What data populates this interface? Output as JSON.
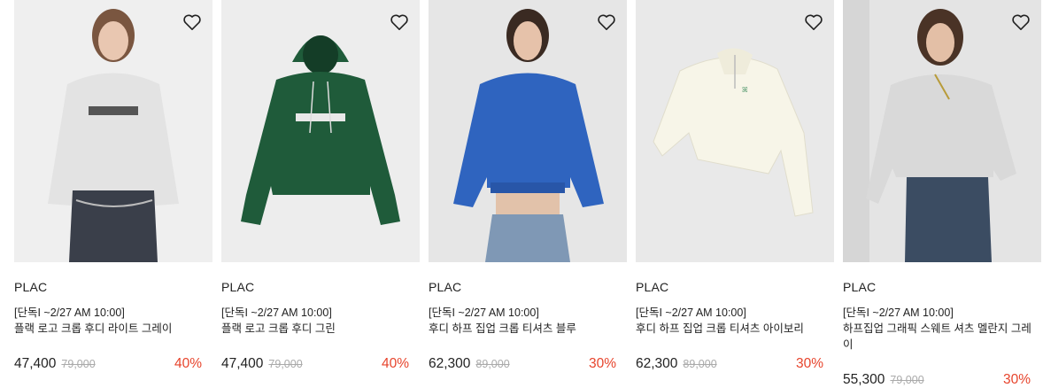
{
  "products": [
    {
      "brand": "PLAC",
      "tag": "[단독I ~2/27 AM 10:00]",
      "name": "플랙 로고 크롭 후디 라이트 그레이",
      "sale_price": "47,400",
      "original_price": "79,000",
      "discount": "40%",
      "garment_color": "#e4e4e4",
      "wish_icon": "heart-outline-icon"
    },
    {
      "brand": "PLAC",
      "tag": "[단독I ~2/27 AM 10:00]",
      "name": "플랙 로고 크롭 후디 그린",
      "sale_price": "47,400",
      "original_price": "79,000",
      "discount": "40%",
      "garment_color": "#1f5b3a",
      "wish_icon": "heart-outline-icon"
    },
    {
      "brand": "PLAC",
      "tag": "[단독I ~2/27 AM 10:00]",
      "name": "후디 하프 집업 크롭 티셔츠 블루",
      "sale_price": "62,300",
      "original_price": "89,000",
      "discount": "30%",
      "garment_color": "#2f64bf",
      "wish_icon": "heart-outline-icon"
    },
    {
      "brand": "PLAC",
      "tag": "[단독I ~2/27 AM 10:00]",
      "name": "후디 하프 집업 크롭 티셔츠 아이보리",
      "sale_price": "62,300",
      "original_price": "89,000",
      "discount": "30%",
      "garment_color": "#f6f4e6",
      "wish_icon": "heart-outline-icon"
    },
    {
      "brand": "PLAC",
      "tag": "[단독I ~2/27 AM 10:00]",
      "name": "하프집업 그래픽 스웨트 셔츠 멜란지 그레이",
      "sale_price": "55,300",
      "original_price": "79,000",
      "discount": "30%",
      "garment_color": "#d8d8d8",
      "wish_icon": "heart-outline-icon"
    }
  ],
  "colors": {
    "discount": "#e7442c",
    "image_bg": "#ededed"
  }
}
